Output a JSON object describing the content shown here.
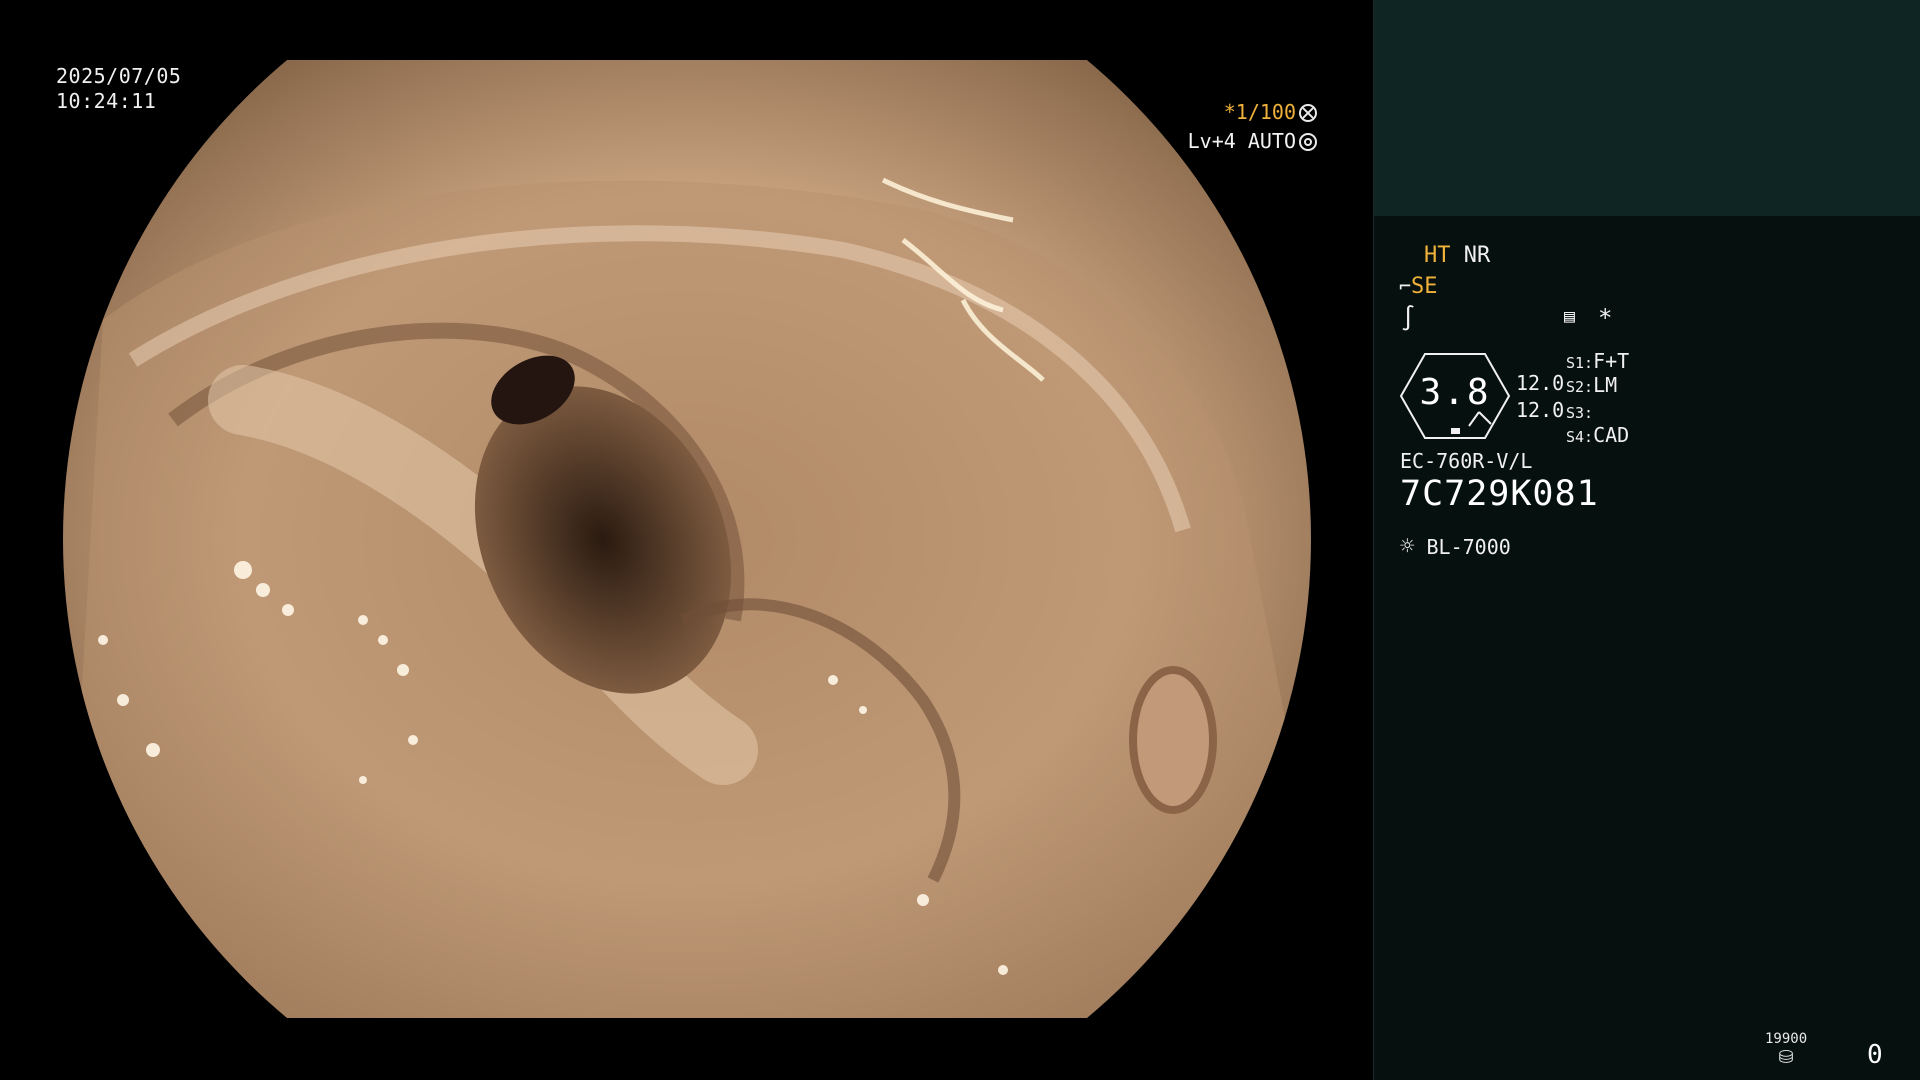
{
  "overlay": {
    "date": "2025/07/05",
    "time": "10:24:11",
    "shutter": "*1/100",
    "level": "Lv+4 AUTO"
  },
  "panel": {
    "ht": "HT",
    "nr": "NR",
    "se": "SE",
    "star": "*",
    "gauge_value": "3.8",
    "val_1": "12.0",
    "val_2": "12.0",
    "s1_label": "S1:",
    "s1_value": "F+T",
    "s2_label": "S2:",
    "s2_value": "LM",
    "s3_label": "S3:",
    "s3_value": "",
    "s4_label": "S4:",
    "s4_value": "CAD",
    "scope_model": "EC-760R-V/L",
    "serial": "7C729K081",
    "light_source": "BL-7000",
    "counter_small": "19900",
    "counter_big": "0"
  },
  "icons": {
    "shutter": "aperture-icon",
    "iris": "iris-icon",
    "structure": "structure-enhance-icon",
    "color": "color-enhance-icon",
    "menu": "menu-icon",
    "light": "light-bulb-icon",
    "disk": "storage-disk-icon"
  },
  "colors": {
    "accent": "#f0b23a",
    "panel_bg": "#06100f",
    "panel_top": "#0e2523"
  }
}
